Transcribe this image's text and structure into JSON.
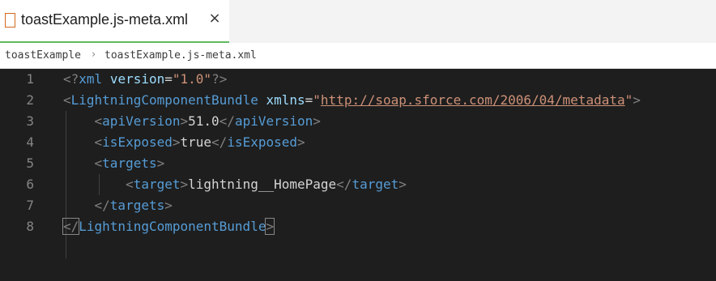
{
  "tab": {
    "label": "toastExample.js-meta.xml",
    "close": "×"
  },
  "breadcrumb": {
    "folder": "toastExample",
    "separator": "›",
    "file": "toastExample.js-meta.xml"
  },
  "editor": {
    "line_numbers": [
      "1",
      "2",
      "3",
      "4",
      "5",
      "6",
      "7",
      "8"
    ],
    "lines": [
      {
        "open": "<?",
        "name": "xml",
        "sp": " ",
        "attr": "version",
        "eq": "=",
        "val": "\"1.0\"",
        "close": "?>"
      },
      {
        "open": "<",
        "name": "LightningComponentBundle",
        "sp": " ",
        "attr": "xmlns",
        "eq": "=",
        "q1": "\"",
        "url": "http://soap.sforce.com/2006/04/metadata",
        "q2": "\"",
        "close": ">"
      },
      {
        "indent": "    ",
        "o1": "<",
        "n1": "apiVersion",
        "c1": ">",
        "text": "51.0",
        "o2": "</",
        "n2": "apiVersion",
        "c2": ">"
      },
      {
        "indent": "    ",
        "o1": "<",
        "n1": "isExposed",
        "c1": ">",
        "text": "true",
        "o2": "</",
        "n2": "isExposed",
        "c2": ">"
      },
      {
        "indent": "    ",
        "open": "<",
        "name": "targets",
        "close": ">"
      },
      {
        "indent": "        ",
        "o1": "<",
        "n1": "target",
        "c1": ">",
        "text": "lightning__HomePage",
        "o2": "</",
        "n2": "target",
        "c2": ">"
      },
      {
        "indent": "    ",
        "open": "</",
        "name": "targets",
        "close": ">"
      },
      {
        "open": "</",
        "name": "LightningComponentBundle",
        "close": ">"
      }
    ]
  },
  "colors": {
    "background": "#1e1e1e",
    "tag": "#569cd6",
    "attribute": "#9cdcfe",
    "string": "#ce9178",
    "punctuation": "#808080",
    "text": "#d4d4d4",
    "line_number": "#858585",
    "active_tab_border": "#5fb85f"
  }
}
